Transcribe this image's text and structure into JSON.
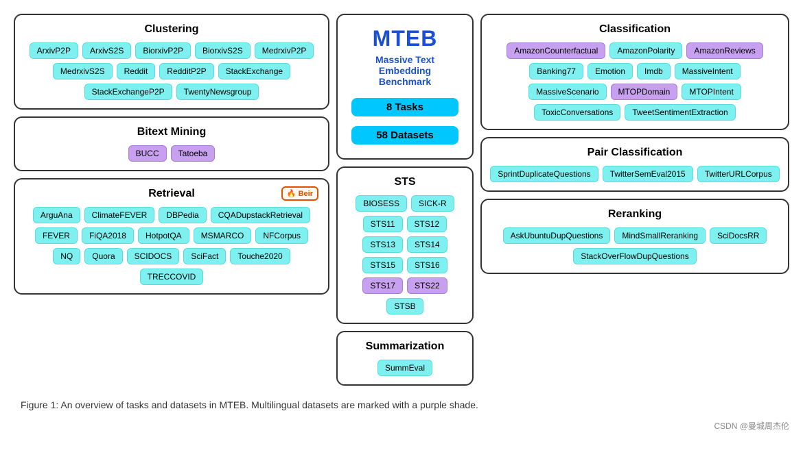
{
  "mteb": {
    "title": "MTEB",
    "subtitle": "Massive Text\nEmbedding Benchmark",
    "tasks_badge": "8 Tasks",
    "datasets_badge": "58 Datasets"
  },
  "clustering": {
    "title": "Clustering",
    "tags": [
      {
        "label": "ArxivP2P",
        "color": "cyan"
      },
      {
        "label": "ArxivS2S",
        "color": "cyan"
      },
      {
        "label": "BiorxivP2P",
        "color": "cyan"
      },
      {
        "label": "BiorxivS2S",
        "color": "cyan"
      },
      {
        "label": "MedrxivP2P",
        "color": "cyan"
      },
      {
        "label": "MedrxivS2S",
        "color": "cyan"
      },
      {
        "label": "Reddit",
        "color": "cyan"
      },
      {
        "label": "RedditP2P",
        "color": "cyan"
      },
      {
        "label": "StackExchange",
        "color": "cyan"
      },
      {
        "label": "StackExchangeP2P",
        "color": "cyan"
      },
      {
        "label": "TwentyNewsgroup",
        "color": "cyan"
      }
    ]
  },
  "bitext_mining": {
    "title": "Bitext Mining",
    "tags": [
      {
        "label": "BUCC",
        "color": "purple"
      },
      {
        "label": "Tatoeba",
        "color": "purple"
      }
    ]
  },
  "retrieval": {
    "title": "Retrieval",
    "beir_label": "Beir",
    "tags": [
      {
        "label": "ArguAna",
        "color": "cyan"
      },
      {
        "label": "ClimateFEVER",
        "color": "cyan"
      },
      {
        "label": "DBPedia",
        "color": "cyan"
      },
      {
        "label": "CQADupstackRetrieval",
        "color": "cyan"
      },
      {
        "label": "FEVER",
        "color": "cyan"
      },
      {
        "label": "FiQA2018",
        "color": "cyan"
      },
      {
        "label": "HotpotQA",
        "color": "cyan"
      },
      {
        "label": "MSMARCO",
        "color": "cyan"
      },
      {
        "label": "NFCorpus",
        "color": "cyan"
      },
      {
        "label": "NQ",
        "color": "cyan"
      },
      {
        "label": "Quora",
        "color": "cyan"
      },
      {
        "label": "SCIDOCS",
        "color": "cyan"
      },
      {
        "label": "SciFact",
        "color": "cyan"
      },
      {
        "label": "Touche2020",
        "color": "cyan"
      },
      {
        "label": "TRECCOVID",
        "color": "cyan"
      }
    ]
  },
  "sts": {
    "title": "STS",
    "tags": [
      {
        "label": "BIOSESS",
        "color": "cyan"
      },
      {
        "label": "SICK-R",
        "color": "cyan"
      },
      {
        "label": "STS11",
        "color": "cyan"
      },
      {
        "label": "STS12",
        "color": "cyan"
      },
      {
        "label": "STS13",
        "color": "cyan"
      },
      {
        "label": "STS14",
        "color": "cyan"
      },
      {
        "label": "STS15",
        "color": "cyan"
      },
      {
        "label": "STS16",
        "color": "cyan"
      },
      {
        "label": "STS17",
        "color": "purple"
      },
      {
        "label": "STS22",
        "color": "purple"
      },
      {
        "label": "STSB",
        "color": "cyan"
      }
    ]
  },
  "summarization": {
    "title": "Summarization",
    "tags": [
      {
        "label": "SummEval",
        "color": "cyan"
      }
    ]
  },
  "classification": {
    "title": "Classification",
    "tags": [
      {
        "label": "AmazonCounterfactual",
        "color": "purple"
      },
      {
        "label": "AmazonPolarity",
        "color": "cyan"
      },
      {
        "label": "AmazonReviews",
        "color": "purple"
      },
      {
        "label": "Banking77",
        "color": "cyan"
      },
      {
        "label": "Emotion",
        "color": "cyan"
      },
      {
        "label": "Imdb",
        "color": "cyan"
      },
      {
        "label": "MassiveIntent",
        "color": "cyan"
      },
      {
        "label": "MassiveScenario",
        "color": "cyan"
      },
      {
        "label": "MTOPDomain",
        "color": "purple"
      },
      {
        "label": "MTOPIntent",
        "color": "cyan"
      },
      {
        "label": "ToxicConversations",
        "color": "cyan"
      },
      {
        "label": "TweetSentimentExtraction",
        "color": "cyan"
      }
    ]
  },
  "pair_classification": {
    "title": "Pair Classification",
    "tags": [
      {
        "label": "SprintDuplicateQuestions",
        "color": "cyan"
      },
      {
        "label": "TwitterSemEval2015",
        "color": "cyan"
      },
      {
        "label": "TwitterURLCorpus",
        "color": "cyan"
      }
    ]
  },
  "reranking": {
    "title": "Reranking",
    "tags": [
      {
        "label": "AskUbuntuDupQuestions",
        "color": "cyan"
      },
      {
        "label": "MindSmallReranking",
        "color": "cyan"
      },
      {
        "label": "SciDocsRR",
        "color": "cyan"
      },
      {
        "label": "StackOverFlowDupQuestions",
        "color": "cyan"
      }
    ]
  },
  "caption": "Figure 1: An overview of tasks and datasets in MTEB. Multilingual datasets are marked with a purple shade.",
  "watermark": "CSDN @曼城周杰伦"
}
